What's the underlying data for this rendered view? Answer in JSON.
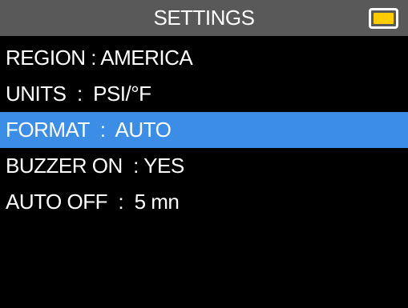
{
  "header": {
    "title": "SETTINGS",
    "battery_icon": "battery-icon"
  },
  "colors": {
    "background": "#000000",
    "title_bar": "#595959",
    "selection": "#3c8de6",
    "battery_fill": "#ffcc00",
    "text": "#ffffff"
  },
  "menu": {
    "items": [
      {
        "label": "REGION : AMERICA",
        "selected": false
      },
      {
        "label": "UNITS  :  PSI/°F",
        "selected": false
      },
      {
        "label": "FORMAT  :  AUTO",
        "selected": true
      },
      {
        "label": "BUZZER ON  : YES",
        "selected": false
      },
      {
        "label": "AUTO OFF  :  5 mn",
        "selected": false
      }
    ]
  }
}
